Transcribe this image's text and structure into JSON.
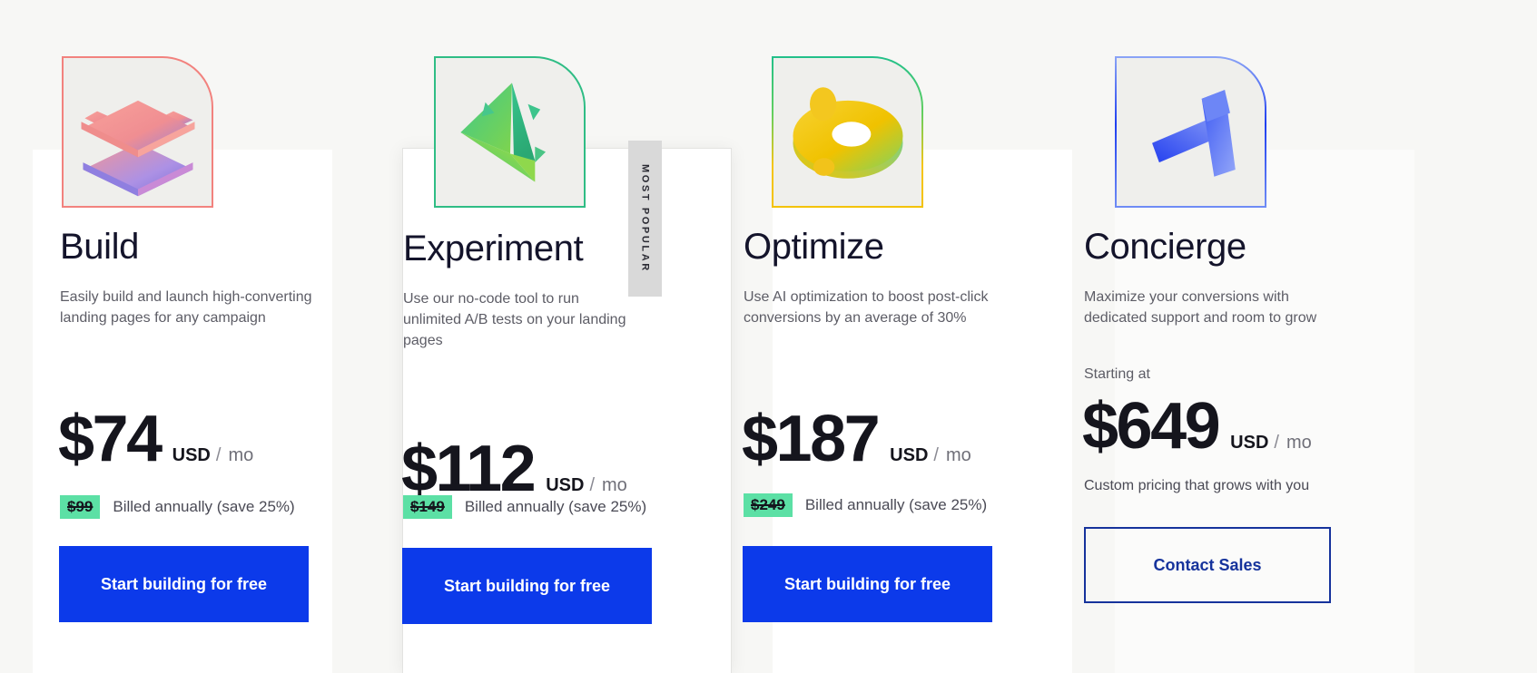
{
  "theme": {
    "page_bg": "#f7f7f5",
    "card_bg": "#ffffff",
    "primary_blue": "#0c3aea",
    "outline_blue": "#16339c",
    "highlight_green": "#5ce0a5",
    "title_color": "#14142b",
    "body_color": "#5d5d66"
  },
  "badge": {
    "label": "MOST POPULAR"
  },
  "plans": [
    {
      "id": "build",
      "name": "Build",
      "icon_name": "layers-stack-icon",
      "accent": "#f2827e",
      "description": "Easily build and launch high-converting landing pages for any campaign",
      "price_amount": "$74",
      "price_currency": "USD",
      "price_separator": "/",
      "price_period": "mo",
      "old_price": "$99",
      "billing_note": "Billed annually (save 25%)",
      "cta_label": "Start building for free",
      "cta_style": "primary"
    },
    {
      "id": "experiment",
      "name": "Experiment",
      "icon_name": "pyramid-prism-icon",
      "accent": "#2fbd85",
      "description": "Use our no-code tool to run unlimited A/B tests on your landing pages",
      "price_amount": "$112",
      "price_currency": "USD",
      "price_separator": "/",
      "price_period": "mo",
      "old_price": "$149",
      "billing_note": "Billed annually (save 25%)",
      "cta_label": "Start building for free",
      "cta_style": "primary",
      "featured": true
    },
    {
      "id": "optimize",
      "name": "Optimize",
      "icon_name": "torus-donut-icon",
      "accent": "#f3c200",
      "description": "Use AI optimization to boost post-click conversions by an average of 30%",
      "price_amount": "$187",
      "price_currency": "USD",
      "price_separator": "/",
      "price_period": "mo",
      "old_price": "$249",
      "billing_note": "Billed annually (save 25%)",
      "cta_label": "Start building for free",
      "cta_style": "primary"
    },
    {
      "id": "concierge",
      "name": "Concierge",
      "icon_name": "arrow-ribbon-icon",
      "accent": "#1f3ff0",
      "description": "Maximize your conversions with dedicated support and room to grow",
      "starting_at": "Starting at",
      "price_amount": "$649",
      "price_currency": "USD",
      "price_separator": "/",
      "price_period": "mo",
      "custom_note": "Custom pricing that grows with you",
      "cta_label": "Contact Sales",
      "cta_style": "outline"
    }
  ]
}
